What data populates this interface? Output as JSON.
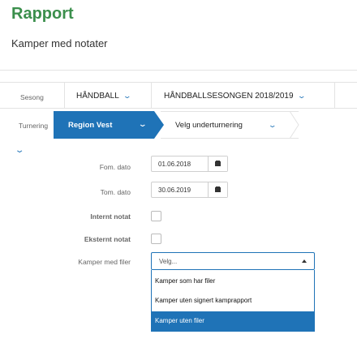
{
  "page": {
    "title": "Rapport",
    "subtitle": "Kamper med notater"
  },
  "season": {
    "label": "Sesong",
    "sport": "HÅNDBALL",
    "season_value": "HÅNDBALLSESONGEN 2018/2019"
  },
  "tournament": {
    "label": "Turnering",
    "active_crumb": "Region Vest",
    "next_crumb": "Velg underturnering"
  },
  "filters": {
    "from_date": {
      "label": "Fom. dato",
      "value": "01.06.2018"
    },
    "to_date": {
      "label": "Tom. dato",
      "value": "30.06.2019"
    },
    "internal_note": {
      "label": "Internt notat",
      "checked": false
    },
    "external_note": {
      "label": "Eksternt notat",
      "checked": false
    },
    "games_with_files": {
      "label": "Kamper med filer",
      "placeholder": "Velg...",
      "options": [
        "Kamper som har filer",
        "Kamper uten signert kamprapport",
        "Kamper uten filer"
      ],
      "highlighted_index": 2
    }
  },
  "icons": {
    "chevron": "chevron-down-icon",
    "calendar": "calendar-icon",
    "caret_up": "caret-up-icon"
  },
  "colors": {
    "title_green": "#3b8f4c",
    "accent_blue": "#1f73b7"
  }
}
